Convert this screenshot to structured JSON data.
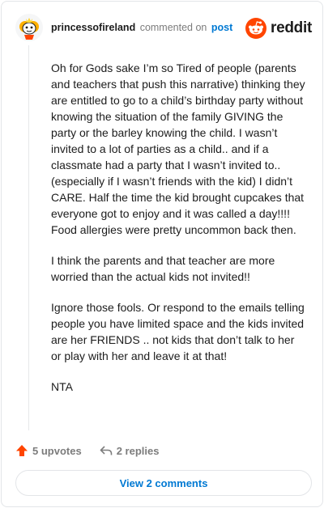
{
  "header": {
    "username": "princessofireland",
    "verb": "commented on",
    "post_link": "post",
    "brand": "reddit"
  },
  "comment": {
    "paragraphs": [
      "Oh for Gods sake I’m so Tired of people (parents and teachers that push this narrative) thinking they are entitled to go to a child’s birthday party without knowing the situation of the family GIVING the party or the barley knowing the child. I wasn’t invited to a lot of parties as a child.. and if a classmate had a party that I wasn’t invited to.. (especially if I wasn’t friends with the kid) I didn’t CARE. Half the time the kid brought cupcakes that everyone got to enjoy and it was called a day!!!! Food allergies were pretty uncommon back then.",
      "I think the parents and that teacher are more worried than the actual kids not invited!!",
      "Ignore those fools. Or respond to the emails telling people you have limited space and the kids invited are her FRIENDS .. not kids that don’t talk to her or play with her and leave it at that!",
      "NTA"
    ]
  },
  "actions": {
    "upvotes": "5 upvotes",
    "replies": "2 replies"
  },
  "footer": {
    "view_comments": "View 2 comments"
  },
  "colors": {
    "brand_orange": "#ff4500",
    "link_blue": "#0079d3",
    "muted": "#7c7c7c"
  }
}
